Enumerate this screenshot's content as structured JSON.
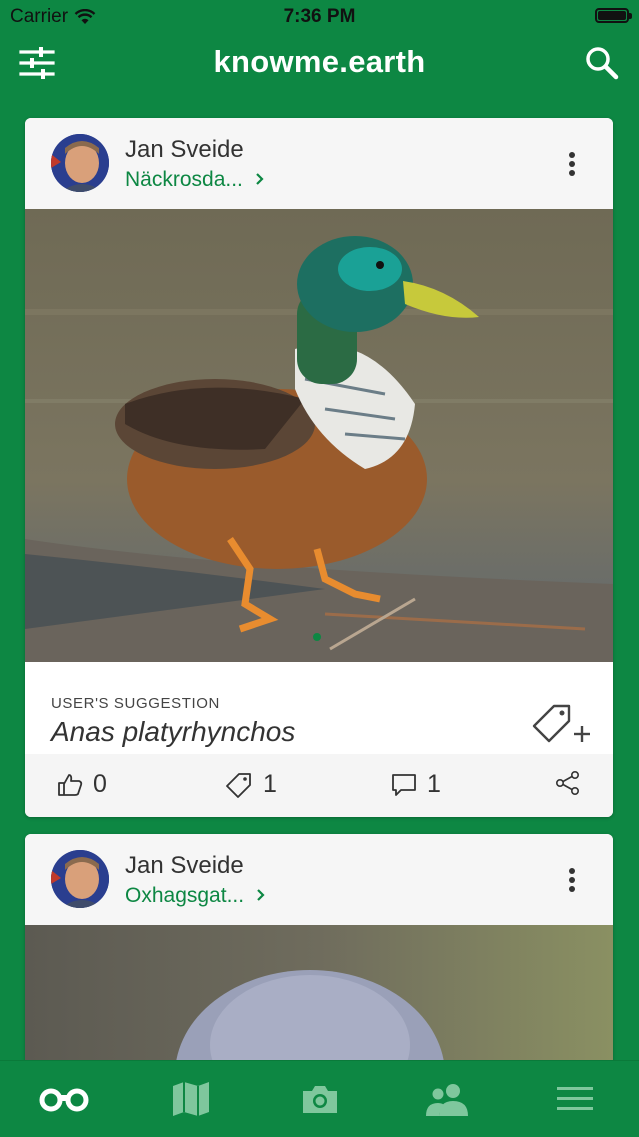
{
  "status_bar": {
    "carrier": "Carrier",
    "time": "7:36 PM"
  },
  "nav": {
    "title": "knowme.earth",
    "left_icon": "filter-sliders-icon",
    "right_icon": "search-icon"
  },
  "posts": [
    {
      "author": "Jan Sveide",
      "location": "Näckrosda...",
      "suggestion_label": "USER'S SUGGESTION",
      "species": "Anas platyrhynchos",
      "likes": "0",
      "tags": "1",
      "comments": "1"
    },
    {
      "author": "Jan Sveide",
      "location": "Oxhagsgat..."
    }
  ],
  "tabs": [
    {
      "name": "explore",
      "icon": "binoculars-icon"
    },
    {
      "name": "map",
      "icon": "map-icon"
    },
    {
      "name": "camera",
      "icon": "camera-icon"
    },
    {
      "name": "people",
      "icon": "people-icon"
    },
    {
      "name": "menu",
      "icon": "menu-icon"
    }
  ],
  "colors": {
    "brand_green": "#0d8743",
    "inactive_tab": "#7fc79d"
  }
}
